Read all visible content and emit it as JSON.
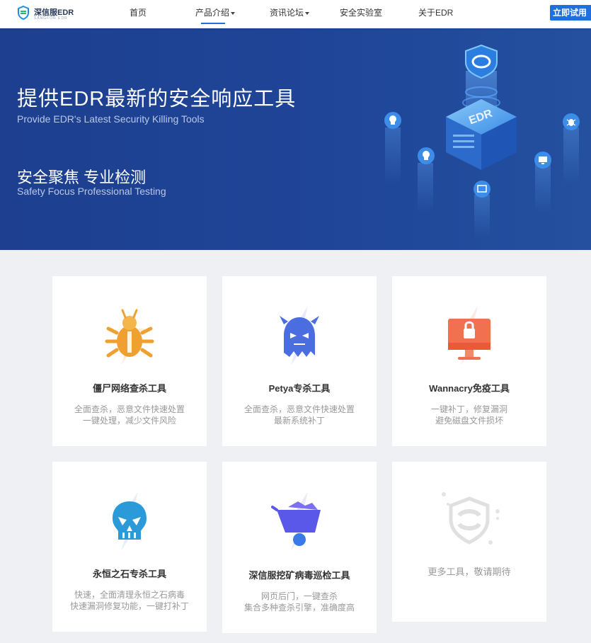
{
  "header": {
    "logo_name": "深信服EDR",
    "logo_sub": "SANGFOR EDR",
    "nav": [
      {
        "label": "首页",
        "dropdown": false
      },
      {
        "label": "产品介绍",
        "dropdown": true,
        "active": true
      },
      {
        "label": "资讯论坛",
        "dropdown": true
      },
      {
        "label": "安全实验室",
        "dropdown": false
      },
      {
        "label": "关于EDR",
        "dropdown": false
      }
    ],
    "cta_label": "立即试用"
  },
  "banner": {
    "title": "提供EDR最新的安全响应工具",
    "subtitle": "Provide EDR's Latest Security Killing Tools",
    "heading2": "安全聚焦 专业检测",
    "subtitle2": "Safety Focus Professional Testing",
    "cube_label": "EDR"
  },
  "tools": [
    {
      "title": "僵尸网络查杀工具",
      "desc": [
        "全面查杀，恶意文件快速处置",
        "一键处理，减少文件风险"
      ],
      "icon": "bug-icon",
      "color": "#f0a030"
    },
    {
      "title": "Petya专杀工具",
      "desc": [
        "全面查杀，恶意文件快速处置",
        "最新系统补丁"
      ],
      "icon": "ghost-icon",
      "color": "#4a6ee0"
    },
    {
      "title": "Wannacry免疫工具",
      "desc": [
        "一键补丁，修复漏洞",
        "避免磁盘文件损坏"
      ],
      "icon": "locked-monitor-icon",
      "color": "#f07050"
    },
    {
      "title": "永恒之石专杀工具",
      "desc": [
        "快速，全面清理永恒之石病毒",
        "快速漏洞修复功能，一键打补丁"
      ],
      "icon": "skull-icon",
      "color": "#2a9ad8"
    },
    {
      "title": "深信服挖矿病毒巡检工具",
      "desc": [
        "网页后门，一键查杀",
        "集合多种查杀引擎，准确度高"
      ],
      "icon": "mining-cart-icon",
      "color": "#5a58e8"
    },
    {
      "title": "",
      "desc": [
        "更多工具，敬请期待"
      ],
      "icon": "sangfor-logo-icon",
      "color": "#dddddd"
    }
  ],
  "colors": {
    "accent": "#1f6fe0",
    "banner": "#1f4598",
    "page_bg": "#eef0f3"
  }
}
